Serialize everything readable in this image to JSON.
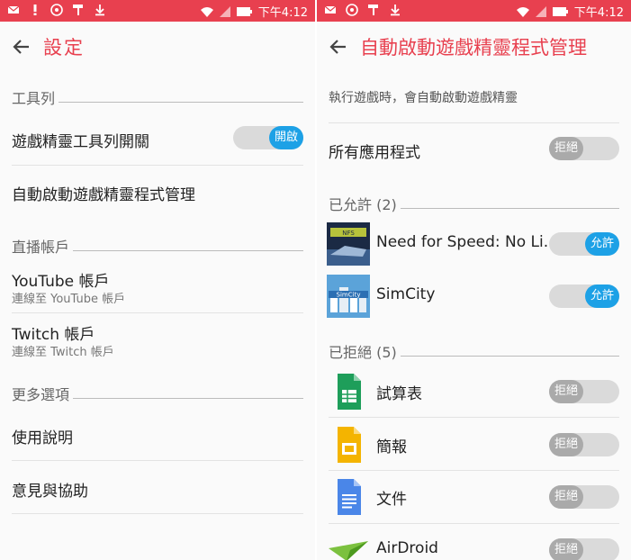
{
  "status_bar": {
    "time": "下午4:12"
  },
  "left": {
    "title": "設定",
    "sections": {
      "toolbar": "工具列",
      "streaming": "直播帳戶",
      "more": "更多選項"
    },
    "toolbar_switch": {
      "label": "遊戲精靈工具列開關",
      "state": "開啟"
    },
    "auto_launch_label": "自動啟動遊戲精靈程式管理",
    "youtube": {
      "label": "YouTube 帳戶",
      "sub": "連線至 YouTube 帳戶"
    },
    "twitch": {
      "label": "Twitch 帳戶",
      "sub": "連線至 Twitch 帳戶"
    },
    "help": "使用說明",
    "feedback": "意見與協助"
  },
  "right": {
    "title": "自動啟動遊戲精靈程式管理",
    "description": "執行遊戲時，會自動啟動遊戲精靈",
    "all_apps": {
      "label": "所有應用程式",
      "state": "拒絕"
    },
    "allowed_header": "已允許 (2)",
    "allowed": [
      {
        "name": "Need for Speed: No Li..",
        "state": "允許",
        "icon": "need-for-speed-icon"
      },
      {
        "name": "SimCity",
        "state": "允許",
        "icon": "simcity-icon"
      }
    ],
    "denied_header": "已拒絕 (5)",
    "denied": [
      {
        "name": "試算表",
        "state": "拒絕",
        "icon": "sheets-icon"
      },
      {
        "name": "簡報",
        "state": "拒絕",
        "icon": "slides-icon"
      },
      {
        "name": "文件",
        "state": "拒絕",
        "icon": "docs-icon"
      },
      {
        "name": "AirDroid",
        "state": "拒絕",
        "icon": "airdroid-icon"
      }
    ]
  },
  "colors": {
    "accent": "#e8404f",
    "toggle_on": "#1da1e6",
    "toggle_off": "#aaaaaa"
  }
}
